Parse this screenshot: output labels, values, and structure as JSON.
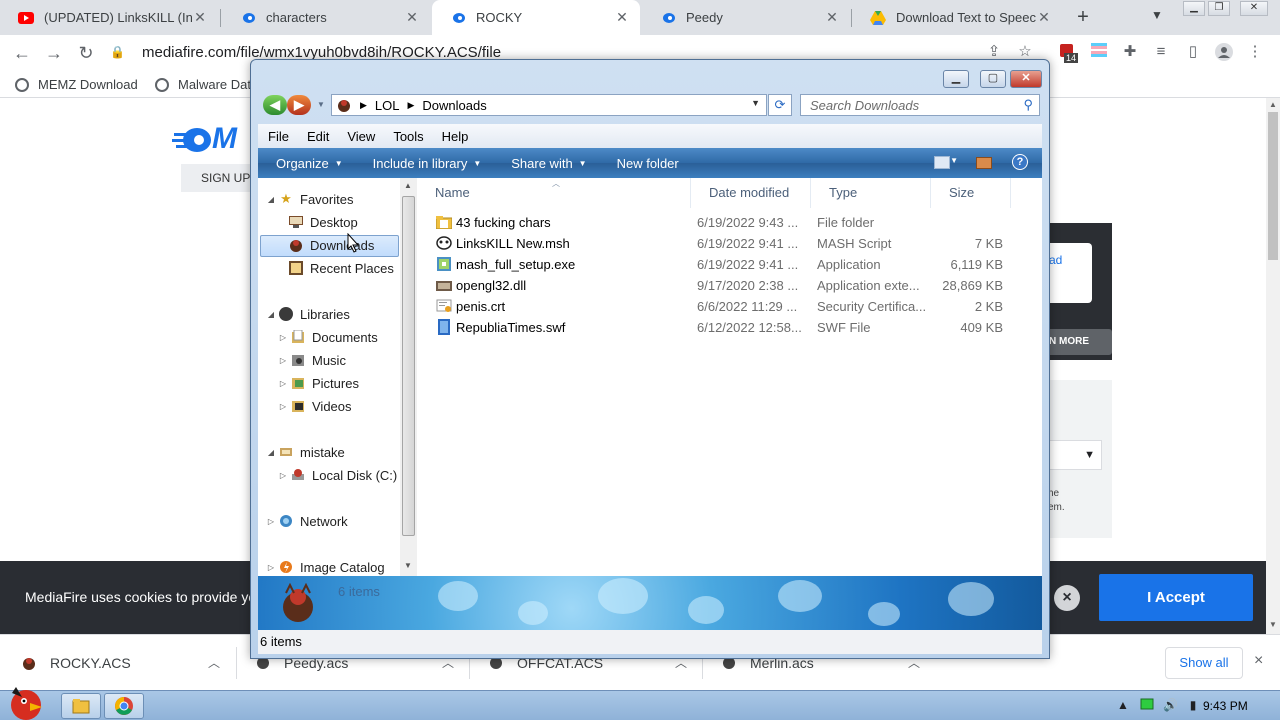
{
  "browser": {
    "tabs": [
      {
        "title": "(UPDATED) LinksKILL (Ins",
        "icon": "youtube-icon"
      },
      {
        "title": "characters",
        "icon": "mediafire-icon"
      },
      {
        "title": "ROCKY",
        "icon": "mediafire-icon",
        "active": true
      },
      {
        "title": "Peedy",
        "icon": "mediafire-icon"
      },
      {
        "title": "Download Text to Speech",
        "icon": "google-drive-icon"
      }
    ],
    "new_tab_glyph": "+",
    "url": "mediafire.com/file/wmx1vyuh0bvd8ih/ROCKY.ACS/file",
    "extension_badge": "14",
    "bookmarks": [
      "MEMZ Download",
      "Malware Dat"
    ]
  },
  "mediafire": {
    "logo": "M",
    "signup": "SIGN UP",
    "download_link": "ad",
    "learn_more": "N MORE",
    "side_text": [
      "he",
      "em."
    ],
    "cookie_text": "MediaFire uses cookies to provide you",
    "cookie_close": "×",
    "accept": "I Accept"
  },
  "download_shelf": {
    "items": [
      "ROCKY.ACS",
      "Peedy.acs",
      "OFFCAT.ACS",
      "Merlin.acs"
    ],
    "show_all": "Show all",
    "close": "×"
  },
  "taskbar": {
    "clock": "9:43 PM"
  },
  "explorer": {
    "breadcrumb": [
      "LOL",
      "Downloads"
    ],
    "search_placeholder": "Search Downloads",
    "menu": [
      "File",
      "Edit",
      "View",
      "Tools",
      "Help"
    ],
    "commands": [
      "Organize",
      "Include in library",
      "Share with",
      "New folder"
    ],
    "help_glyph": "?",
    "nav": {
      "favorites": "Favorites",
      "desktop": "Desktop",
      "downloads": "Downloads",
      "recent": "Recent Places",
      "libraries": "Libraries",
      "documents": "Documents",
      "music": "Music",
      "pictures": "Pictures",
      "videos": "Videos",
      "homegroup": "mistake",
      "local_disk": "Local Disk (C:)",
      "network": "Network",
      "image_catalog": "Image Catalog"
    },
    "columns": {
      "name": "Name",
      "date": "Date modified",
      "type": "Type",
      "size": "Size"
    },
    "files": [
      {
        "name": "43 fucking chars",
        "date": "6/19/2022 9:43 ...",
        "type": "File folder",
        "size": "",
        "icon": "folder-icon"
      },
      {
        "name": "LinksKILL New.msh",
        "date": "6/19/2022 9:41 ...",
        "type": "MASH Script",
        "size": "7 KB",
        "icon": "mash-script-icon"
      },
      {
        "name": "mash_full_setup.exe",
        "date": "6/19/2022 9:41 ...",
        "type": "Application",
        "size": "6,119 KB",
        "icon": "setup-exe-icon"
      },
      {
        "name": "opengl32.dll",
        "date": "9/17/2020 2:38 ...",
        "type": "Application exte...",
        "size": "28,869 KB",
        "icon": "dll-icon"
      },
      {
        "name": "penis.crt",
        "date": "6/6/2022 11:29 ...",
        "type": "Security Certifica...",
        "size": "2 KB",
        "icon": "certificate-icon"
      },
      {
        "name": "RepubliaTimes.swf",
        "date": "6/12/2022 12:58...",
        "type": "SWF File",
        "size": "409 KB",
        "icon": "swf-file-icon"
      }
    ],
    "details_count": "6 items",
    "status": "6 items"
  }
}
